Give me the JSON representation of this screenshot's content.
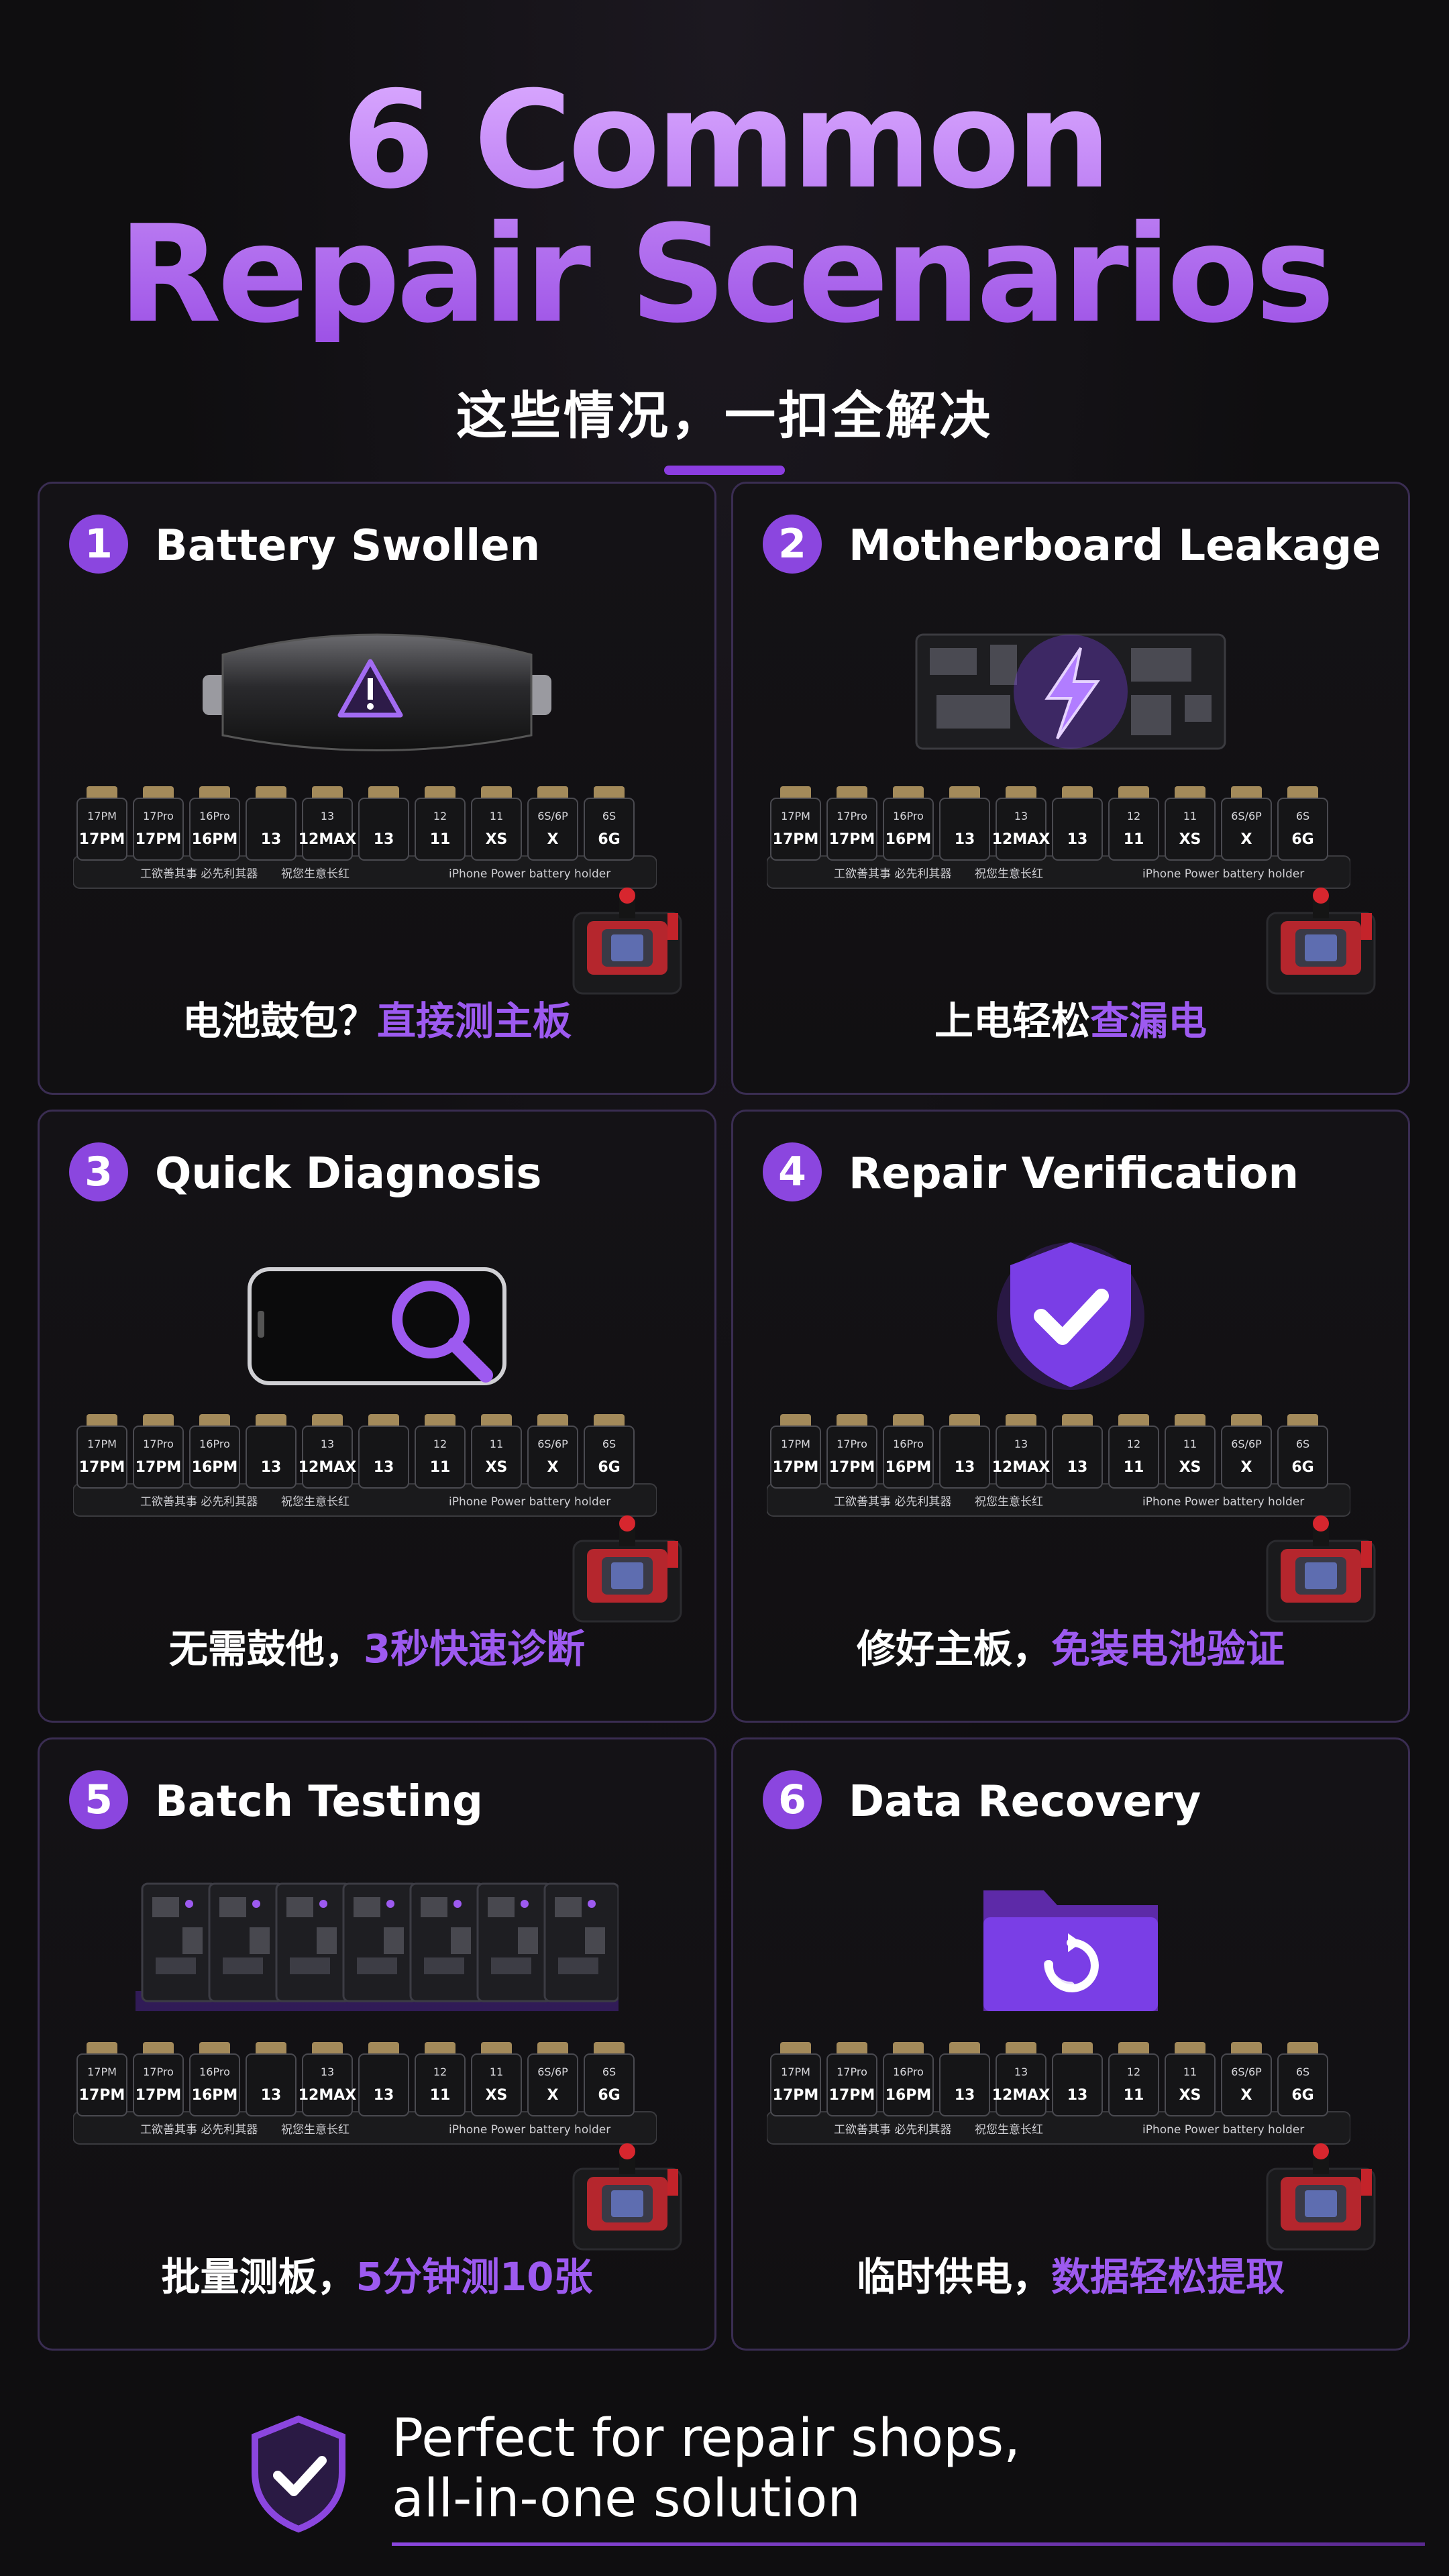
{
  "header": {
    "title_line1": "6 Common",
    "title_line2": "Repair Scenarios",
    "subtitle": "这些情况，一扣全解决"
  },
  "colors": {
    "accent": "#8b46df",
    "highlight": "#9d5af0",
    "background": "#0f0e10",
    "card_border": "#3a2d52",
    "tester_red": "#d7262e"
  },
  "cards": [
    {
      "number": "1",
      "title": "Battery Swollen",
      "icon": "swollen-battery-warning-icon",
      "caption_plain": "电池鼓包？",
      "caption_highlight": "直接测主板"
    },
    {
      "number": "2",
      "title": "Motherboard Leakage",
      "icon": "motherboard-lightning-icon",
      "caption_plain": "上电轻松",
      "caption_highlight": "查漏电"
    },
    {
      "number": "3",
      "title": "Quick Diagnosis",
      "icon": "phone-magnifier-icon",
      "caption_plain": "无需鼓他，",
      "caption_highlight": "3秒快速诊断"
    },
    {
      "number": "4",
      "title": "Repair Verification",
      "icon": "shield-check-icon",
      "caption_plain": "修好主板，",
      "caption_highlight": "免装电池验证"
    },
    {
      "number": "5",
      "title": "Batch Testing",
      "icon": "stacked-motherboards-icon",
      "caption_plain": "批量测板，",
      "caption_highlight": "5分钟测10张"
    },
    {
      "number": "6",
      "title": "Data Recovery",
      "icon": "folder-sync-icon",
      "caption_plain": "临时供电，",
      "caption_highlight": "数据轻松提取"
    }
  ],
  "board": {
    "connector_labels": [
      "17PM",
      "17PM",
      "16PM",
      "13",
      "12MAX",
      "13",
      "11",
      "XS",
      "X",
      "6G"
    ],
    "connector_top_labels": [
      "17PM",
      "17Pro",
      "16Pro",
      "",
      "13",
      "",
      "12",
      "11",
      "6S/6P",
      "6S",
      ""
    ],
    "bottom_text_left": "工欲善其事 必先利其器",
    "bottom_text_mid": "祝您生意长红",
    "bottom_text_right": "iPhone Power battery holder"
  },
  "footer": {
    "line1": "Perfect for repair shops,",
    "line2": "all-in-one solution",
    "icon": "shield-check-icon"
  }
}
